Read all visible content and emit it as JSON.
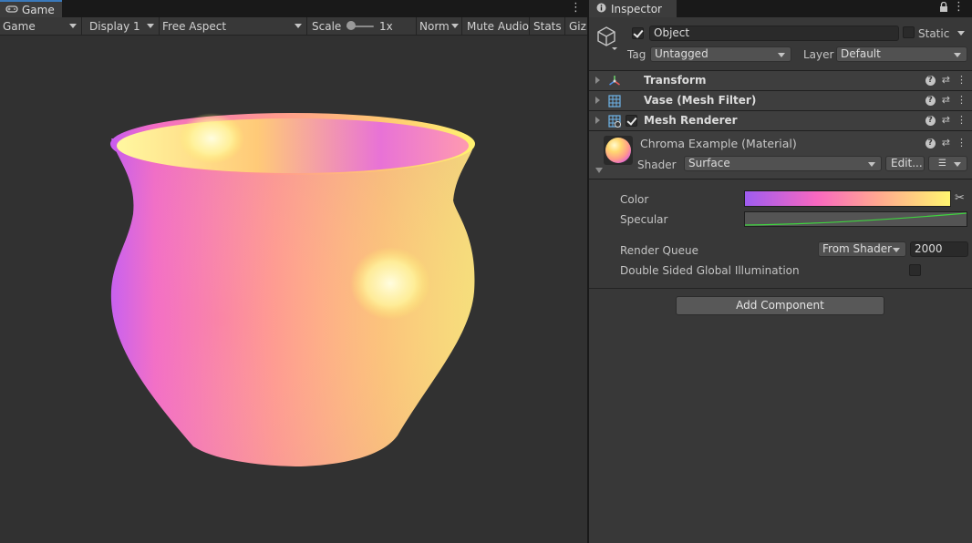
{
  "game_panel": {
    "tab_label": "Game",
    "toolbar": {
      "view_mode": "Game",
      "display": "Display 1",
      "aspect": "Free Aspect",
      "scale_label": "Scale",
      "scale_value": "1x",
      "scale_level": 0,
      "vsync_mode": "Norma",
      "mute_audio": "Mute Audio",
      "stats": "Stats",
      "gizmos": "Giz"
    }
  },
  "inspector": {
    "tab_label": "Inspector",
    "object": {
      "active": true,
      "name": "Object",
      "static_label": "Static",
      "tag_label": "Tag",
      "tag_value": "Untagged",
      "layer_label": "Layer",
      "layer_value": "Default"
    },
    "components": [
      {
        "title": "Transform",
        "icon": "transform-icon"
      },
      {
        "title": "Vase (Mesh Filter)",
        "icon": "mesh-filter-icon"
      },
      {
        "title": "Mesh Renderer",
        "icon": "mesh-renderer-icon",
        "enabled": true
      }
    ],
    "material": {
      "name": "Chroma Example (Material)",
      "shader_label": "Shader",
      "shader_value": "Surface",
      "edit_label": "Edit...",
      "color_label": "Color",
      "specular_label": "Specular",
      "render_queue_label": "Render Queue",
      "render_queue_mode": "From Shader",
      "render_queue_value": "2000",
      "double_sided_label": "Double Sided Global Illumination",
      "double_sided": false
    },
    "add_component_label": "Add Component"
  },
  "colors": {
    "gradient_start": "#9e5cf0",
    "gradient_mid": "#f868c0",
    "gradient_end": "#fff570",
    "specular_line": "#3fd43f",
    "accent": "#3a79bb"
  }
}
